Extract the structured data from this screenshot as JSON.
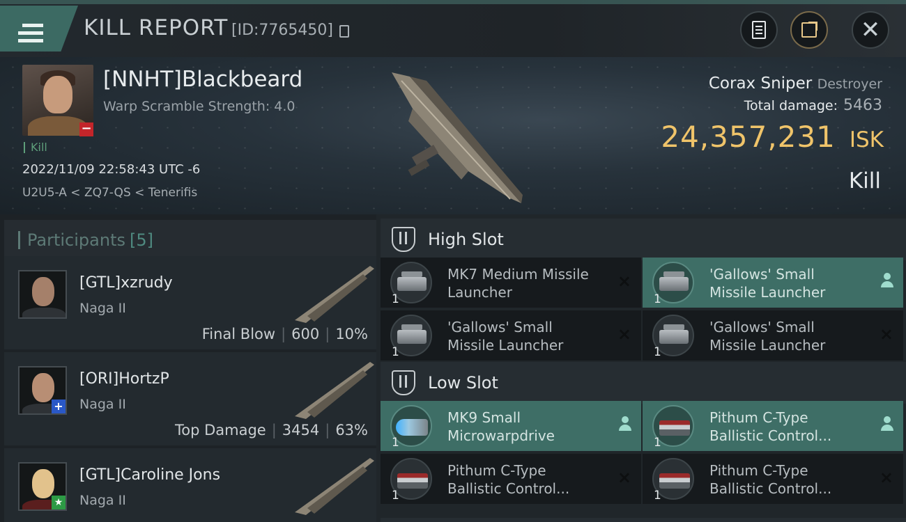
{
  "header": {
    "title": "KILL REPORT",
    "id_label": "[ID:7765450]",
    "buttons": {
      "report": "document-icon",
      "share": "share-icon",
      "close": "close-icon"
    }
  },
  "victim": {
    "name": "[NNHT]Blackbeard",
    "warp_scramble": "Warp Scramble Strength: 4.0",
    "kill_tag": "Kill",
    "timestamp": "2022/11/09 22:58:43 UTC -6",
    "location": "U2U5-A < ZQ7-QS < Tenerifis",
    "ship_name": "Corax Sniper",
    "ship_class": "Destroyer",
    "total_damage_label": "Total damage:",
    "total_damage": "5463",
    "isk_value": "24,357,231",
    "isk_unit": "ISK",
    "result": "Kill"
  },
  "participants": {
    "label": "Participants",
    "count": "[5]",
    "rows": [
      {
        "name": "[GTL]xzrudy",
        "ship": "Naga II",
        "role": "Final Blow",
        "damage": "600",
        "percent": "10%",
        "badge": ""
      },
      {
        "name": "[ORI]HortzP",
        "ship": "Naga II",
        "role": "Top Damage",
        "damage": "3454",
        "percent": "63%",
        "badge": "+"
      },
      {
        "name": "[GTL]Caroline Jons",
        "ship": "Naga II",
        "role": "",
        "damage": "",
        "percent": "",
        "badge": "★"
      }
    ]
  },
  "fitting": {
    "high_slot": {
      "title": "High Slot",
      "modules": [
        {
          "qty": "1",
          "line1": "MK7 Medium Missile",
          "line2": "Launcher",
          "state": "destroyed"
        },
        {
          "qty": "1",
          "line1": "'Gallows' Small",
          "line2": "Missile Launcher",
          "state": "dropped"
        },
        {
          "qty": "1",
          "line1": "'Gallows' Small",
          "line2": "Missile Launcher",
          "state": "destroyed"
        },
        {
          "qty": "1",
          "line1": "'Gallows' Small",
          "line2": "Missile Launcher",
          "state": "destroyed"
        }
      ]
    },
    "low_slot": {
      "title": "Low Slot",
      "modules": [
        {
          "qty": "1",
          "line1": "MK9 Small",
          "line2": "Microwarpdrive",
          "state": "dropped"
        },
        {
          "qty": "1",
          "line1": "Pithum C-Type",
          "line2": "Ballistic Control...",
          "state": "dropped"
        },
        {
          "qty": "1",
          "line1": "Pithum C-Type",
          "line2": "Ballistic Control...",
          "state": "destroyed"
        },
        {
          "qty": "1",
          "line1": "Pithum C-Type",
          "line2": "Ballistic Control...",
          "state": "destroyed"
        }
      ]
    },
    "destroyed_mark": "×"
  },
  "colors": {
    "accent": "#3e6e66",
    "isk": "#f0c46a",
    "loss_badge": "#c3252a"
  }
}
